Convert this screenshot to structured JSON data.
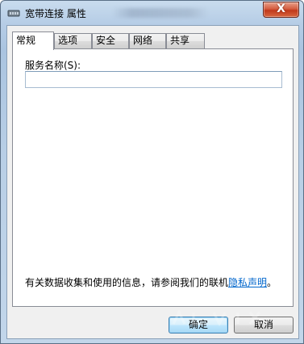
{
  "window": {
    "title": "宽带连接 属性",
    "close_label": "X"
  },
  "tabs": [
    {
      "label": "常规",
      "active": true
    },
    {
      "label": "选项",
      "active": false
    },
    {
      "label": "安全",
      "active": false
    },
    {
      "label": "网络",
      "active": false
    },
    {
      "label": "共享",
      "active": false
    }
  ],
  "general": {
    "service_name_label": "服务名称(S):",
    "service_name_value": "",
    "privacy_text": "有关数据收集和使用的信息，请参阅我们的联机",
    "privacy_link": "隐私声明",
    "privacy_end": "。"
  },
  "buttons": {
    "ok": "确定",
    "cancel": "取消"
  },
  "icons": {
    "title_icon": "broadband-connection-icon",
    "close_icon": "close-icon"
  }
}
